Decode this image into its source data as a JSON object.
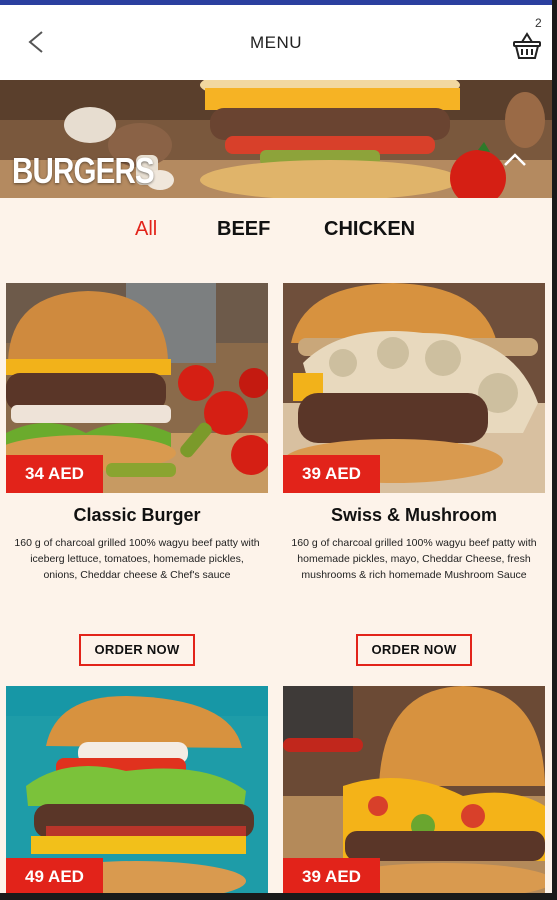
{
  "header": {
    "title": "MENU",
    "cart_count": "2"
  },
  "hero": {
    "title": "BURGERS"
  },
  "filters": [
    {
      "label": "All",
      "active": true
    },
    {
      "label": "BEEF",
      "active": false
    },
    {
      "label": "CHICKEN",
      "active": false
    }
  ],
  "items": [
    {
      "price": "34 AED",
      "name": "Classic Burger",
      "description": "160 g of charcoal grilled 100% wagyu beef patty with iceberg lettuce, tomatoes, homemade pickles, onions, Cheddar cheese & Chef's sauce",
      "button": "ORDER NOW"
    },
    {
      "price": "39 AED",
      "name": "Swiss & Mushroom",
      "description": "160 g of charcoal grilled 100% wagyu beef patty with homemade pickles, mayo, Cheddar Cheese, fresh mushrooms & rich homemade Mushroom Sauce",
      "button": "ORDER NOW"
    },
    {
      "price": "49 AED"
    },
    {
      "price": "39 AED"
    }
  ],
  "colors": {
    "accent": "#e2231a",
    "background": "#fdf3ea",
    "status_bar": "#2b3f9f"
  }
}
